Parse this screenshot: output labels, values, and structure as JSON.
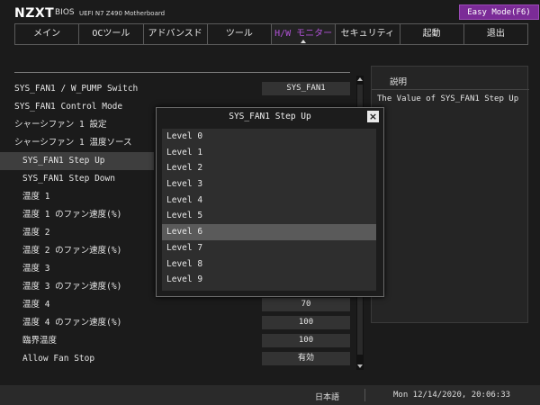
{
  "header": {
    "logo": "NZXT",
    "bios": "BIOS",
    "subtitle": "UEFI N7 Z490 Motherboard",
    "easy_mode_label": "Easy Mode(F6)"
  },
  "tabs": [
    {
      "label": "メイン",
      "active": false
    },
    {
      "label": "OCツール",
      "active": false
    },
    {
      "label": "アドバンスド",
      "active": false
    },
    {
      "label": "ツール",
      "active": false
    },
    {
      "label": "H/W モニター",
      "active": true
    },
    {
      "label": "セキュリティ",
      "active": false
    },
    {
      "label": "起動",
      "active": false
    },
    {
      "label": "退出",
      "active": false
    }
  ],
  "settings": [
    {
      "label": "SYS_FAN1 / W_PUMP Switch",
      "value": "SYS_FAN1"
    },
    {
      "label": "SYS_FAN1 Control Mode",
      "value": ""
    },
    {
      "label": "シャーシファン 1 設定",
      "value": ""
    },
    {
      "label": "シャーシファン 1 温度ソース",
      "value": ""
    },
    {
      "label": "SYS_FAN1 Step Up",
      "value": ""
    },
    {
      "label": "SYS_FAN1 Step Down",
      "value": ""
    },
    {
      "label": "温度 1",
      "value": ""
    },
    {
      "label": "温度 1 のファン速度(%)",
      "value": ""
    },
    {
      "label": "温度 2",
      "value": ""
    },
    {
      "label": "温度 2 のファン速度(%)",
      "value": ""
    },
    {
      "label": "温度 3",
      "value": ""
    },
    {
      "label": "温度 3 のファン速度(%)",
      "value": ""
    },
    {
      "label": "温度 4",
      "value": "70"
    },
    {
      "label": "温度 4 のファン速度(%)",
      "value": "100"
    },
    {
      "label": "臨界温度",
      "value": "100"
    },
    {
      "label": "Allow Fan Stop",
      "value": "有効"
    }
  ],
  "help": {
    "title": "説明",
    "text": "The Value of SYS_FAN1 Step Up"
  },
  "dialog": {
    "title": "SYS_FAN1 Step Up",
    "close_label": "×",
    "options": [
      "Level 0",
      "Level 1",
      "Level 2",
      "Level 3",
      "Level 4",
      "Level 5",
      "Level 6",
      "Level 7",
      "Level 8",
      "Level 9"
    ],
    "selected_index": 6
  },
  "status": {
    "language": "日本語",
    "datetime": "Mon 12/14/2020, 20:06:33"
  },
  "colors": {
    "accent": "#b052d6",
    "easy_mode_bg": "#7b2b97",
    "background": "#1b1b1b"
  }
}
